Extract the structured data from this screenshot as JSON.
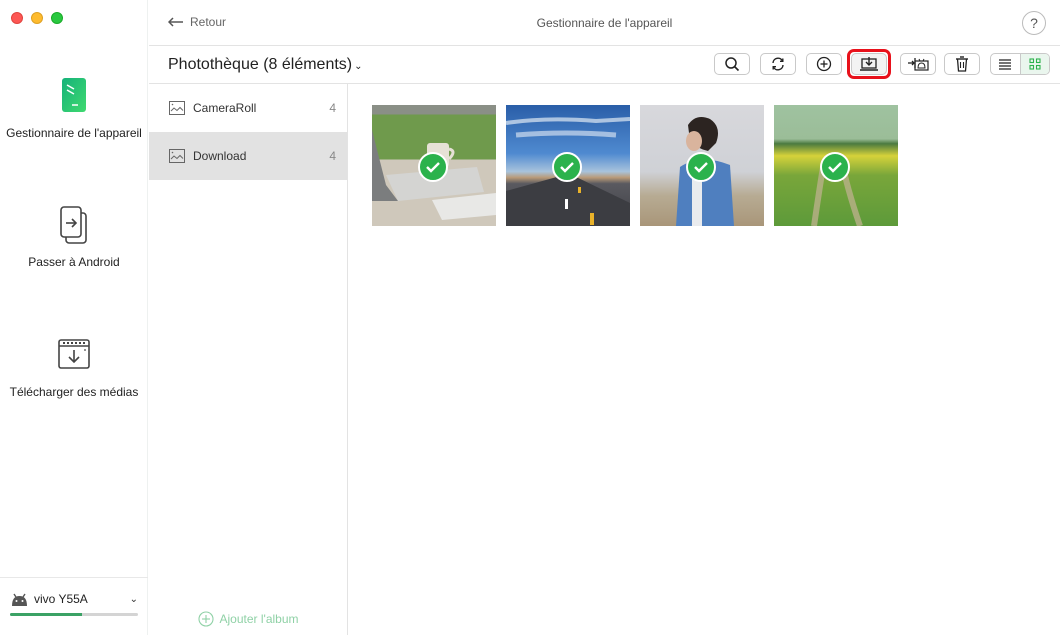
{
  "window": {
    "title": "Gestionnaire de l'appareil",
    "back_label": "Retour",
    "help_label": "?"
  },
  "leftnav": {
    "items": [
      {
        "label": "Gestionnaire de l'appareil",
        "icon": "phone-icon",
        "active": true
      },
      {
        "label": "Passer à Android",
        "icon": "switch-phone-icon"
      },
      {
        "label": "Télécharger des médias",
        "icon": "media-download-icon"
      }
    ],
    "device": {
      "name": "vivo Y55A",
      "icon": "android-icon",
      "storage_used_percent": 56
    }
  },
  "toolbar": {
    "library_title": "Photothèque (8 éléments)",
    "library_chevron": "⌄",
    "buttons": [
      {
        "name": "search",
        "icon": "search-icon"
      },
      {
        "name": "refresh",
        "icon": "refresh-icon"
      },
      {
        "name": "add",
        "icon": "plus-circle-icon"
      },
      {
        "name": "export-to-computer",
        "icon": "export-icon",
        "highlighted": true
      },
      {
        "name": "send-to-device",
        "icon": "to-android-icon"
      },
      {
        "name": "delete",
        "icon": "trash-icon"
      }
    ],
    "view_modes": [
      {
        "name": "list",
        "icon": "list-icon",
        "active": false
      },
      {
        "name": "grid",
        "icon": "grid-icon",
        "active": true
      }
    ],
    "highlight_color": "#e8111b"
  },
  "albums": {
    "items": [
      {
        "name": "CameraRoll",
        "count": "4",
        "active": false
      },
      {
        "name": "Download",
        "count": "4",
        "active": true
      }
    ],
    "add_label": "Ajouter l'album"
  },
  "photos": [
    {
      "subject": "laptop and coffee cup",
      "selected": true
    },
    {
      "subject": "desert road under blue sky",
      "selected": true
    },
    {
      "subject": "person in blue shirt",
      "selected": true
    },
    {
      "subject": "rapeseed field path",
      "selected": true
    }
  ],
  "colors": {
    "accent_green": "#2bb24c",
    "storage_green": "#3ba265"
  }
}
